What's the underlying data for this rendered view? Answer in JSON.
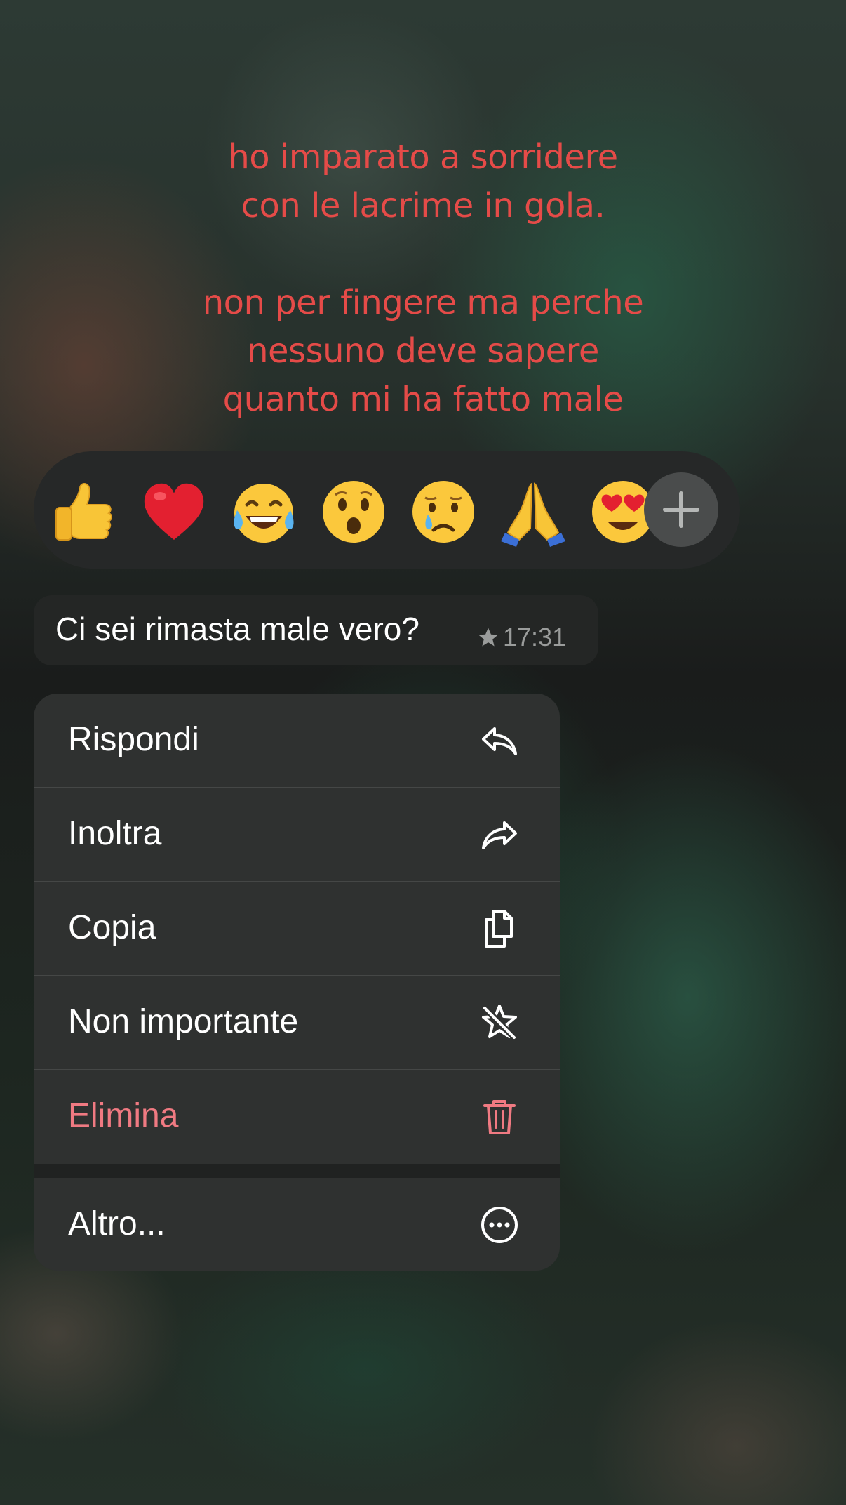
{
  "caption": {
    "lines": [
      "ho imparato a sorridere",
      "con le lacrime in gola.",
      "",
      "non per fingere ma perche",
      "nessuno deve sapere",
      "quanto mi ha fatto male"
    ]
  },
  "reactions": {
    "items": [
      {
        "name": "thumbs-up-emoji"
      },
      {
        "name": "red-heart-emoji"
      },
      {
        "name": "tears-of-joy-emoji"
      },
      {
        "name": "surprised-face-emoji"
      },
      {
        "name": "crying-face-emoji"
      },
      {
        "name": "folded-hands-emoji"
      },
      {
        "name": "heart-eyes-emoji"
      }
    ],
    "more_icon": "plus-icon"
  },
  "message": {
    "text": "Ci sei rimasta male vero?",
    "starred_icon": "star-icon",
    "time": "17:31"
  },
  "menu": {
    "items": [
      {
        "label": "Rispondi",
        "icon": "reply-icon"
      },
      {
        "label": "Inoltra",
        "icon": "forward-icon"
      },
      {
        "label": "Copia",
        "icon": "copy-icon"
      },
      {
        "label": "Non importante",
        "icon": "unstar-icon"
      },
      {
        "label": "Elimina",
        "icon": "trash-icon"
      },
      {
        "label": "Altro...",
        "icon": "more-icon"
      }
    ]
  },
  "colors": {
    "caption_text": "#e54b48",
    "menu_background": "#2f3130",
    "danger": "#f07a82",
    "bubble_background": "#242625",
    "meta_text": "#9a9c9b"
  }
}
